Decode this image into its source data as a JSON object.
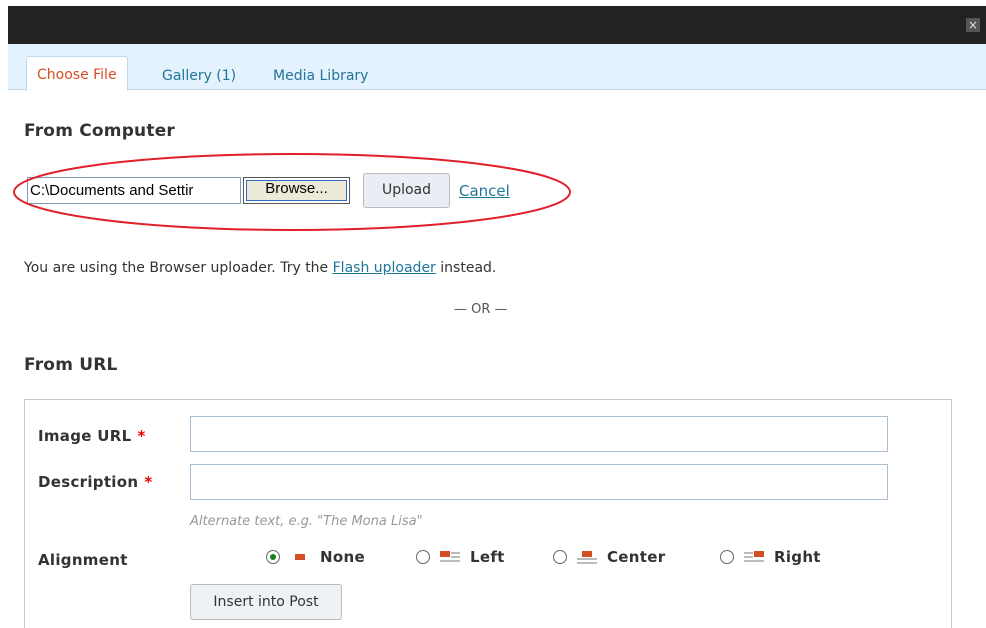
{
  "window": {
    "close_glyph": "×"
  },
  "tabs": [
    {
      "label": "Choose File",
      "active": true
    },
    {
      "label": "Gallery (1)",
      "active": false
    },
    {
      "label": "Media Library",
      "active": false
    }
  ],
  "from_computer": {
    "heading": "From Computer",
    "file_value": "C:\\Documents and Settir",
    "browse_label": "Browse...",
    "upload_label": "Upload",
    "cancel_label": "Cancel"
  },
  "notice": {
    "prefix": "You are using the Browser uploader. Try the",
    "link": "Flash uploader",
    "suffix": "instead."
  },
  "separator": "— OR —",
  "from_url": {
    "heading": "From URL",
    "image_url_label": "Image URL",
    "description_label": "Description",
    "required_mark": "*",
    "image_url_value": "",
    "description_value": "",
    "description_hint": "Alternate text, e.g. \"The Mona Lisa\"",
    "alignment_label": "Alignment",
    "alignment_options": [
      {
        "label": "None",
        "checked": true
      },
      {
        "label": "Left",
        "checked": false
      },
      {
        "label": "Center",
        "checked": false
      },
      {
        "label": "Right",
        "checked": false
      }
    ],
    "insert_label": "Insert into Post"
  },
  "colors": {
    "accent_link": "#21759b",
    "active_tab": "#d54e21",
    "highlight_ellipse": "#e0202a",
    "required": "#ee0000"
  }
}
